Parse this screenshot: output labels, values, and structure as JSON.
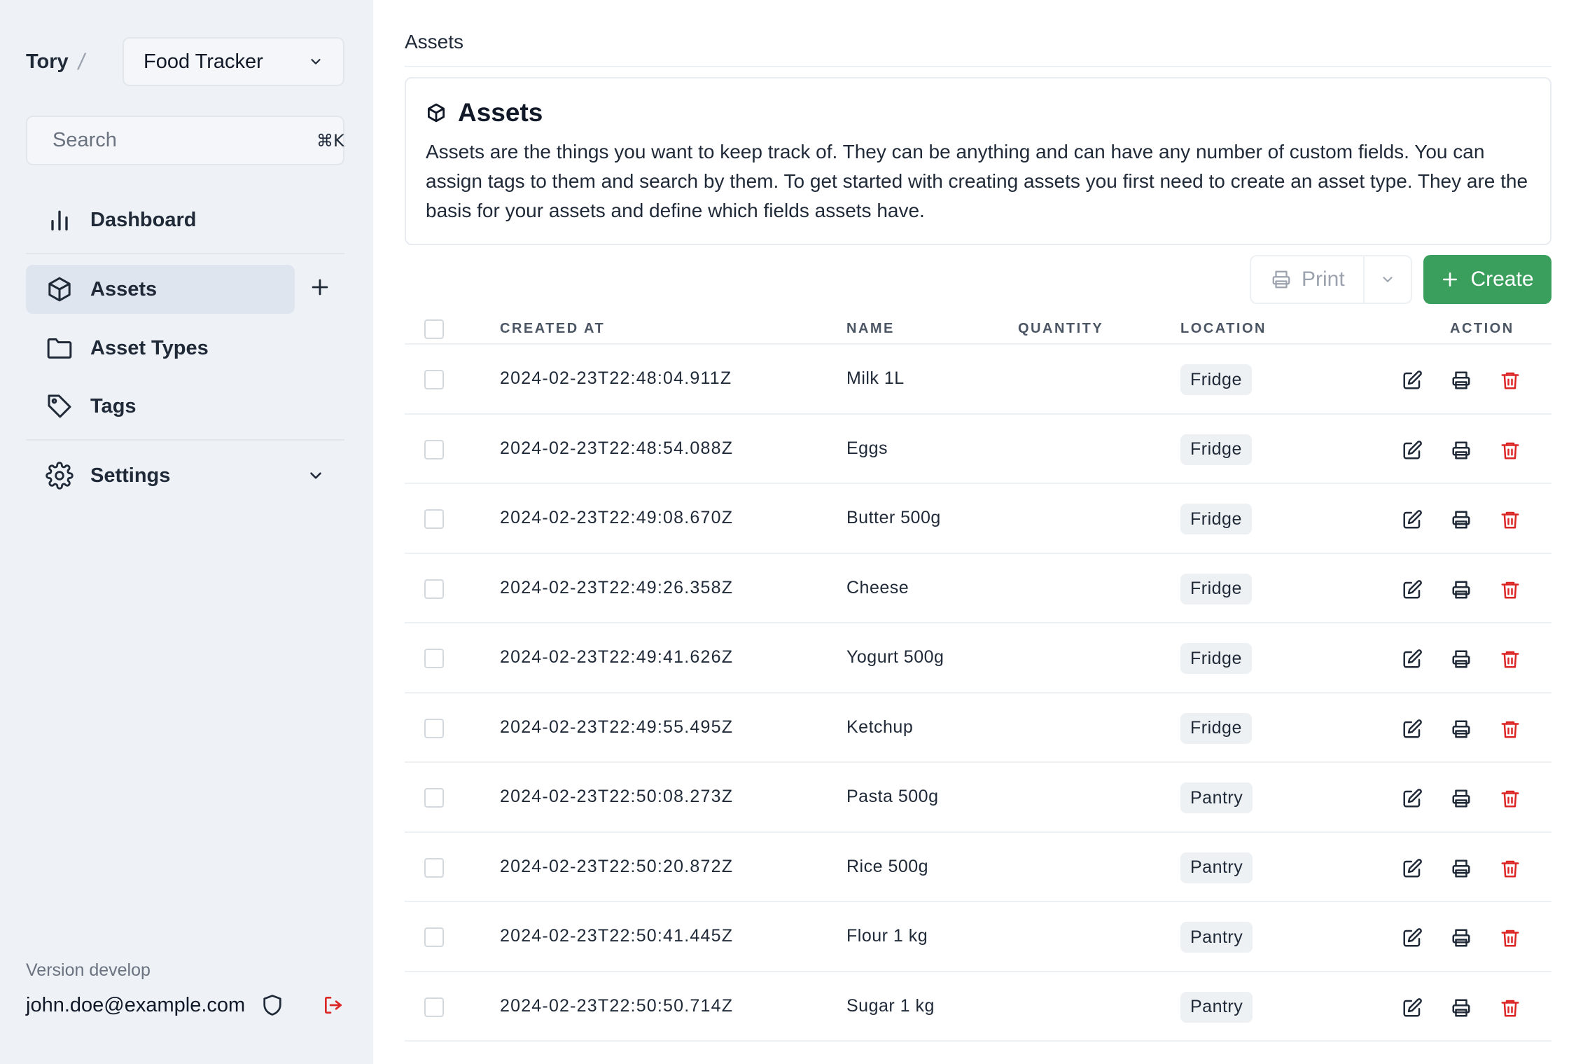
{
  "sidebar": {
    "team": "Tory",
    "separator": "/",
    "project": "Food Tracker",
    "search": {
      "placeholder": "Search",
      "shortcut": "⌘K"
    },
    "nav": {
      "dashboard": "Dashboard",
      "assets": "Assets",
      "asset_types": "Asset Types",
      "tags": "Tags",
      "settings": "Settings"
    },
    "version": "Version develop",
    "user_email": "john.doe@example.com"
  },
  "main": {
    "breadcrumb": "Assets",
    "intro": {
      "title": "Assets",
      "text": "Assets are the things you want to keep track of. They can be anything and can have any number of custom fields. You can assign tags to them and search by them. To get started with creating assets you first need to create an asset type. They are the basis for your assets and define which fields assets have."
    },
    "toolbar": {
      "print_label": "Print",
      "create_label": "Create"
    },
    "table": {
      "columns": {
        "created_at": "CREATED AT",
        "name": "NAME",
        "quantity": "QUANTITY",
        "location": "LOCATION",
        "action": "ACTION"
      },
      "rows": [
        {
          "created_at": "2024-02-23T22:48:04.911Z",
          "name": "Milk 1L",
          "quantity": "",
          "location": "Fridge"
        },
        {
          "created_at": "2024-02-23T22:48:54.088Z",
          "name": "Eggs",
          "quantity": "",
          "location": "Fridge"
        },
        {
          "created_at": "2024-02-23T22:49:08.670Z",
          "name": "Butter 500g",
          "quantity": "",
          "location": "Fridge"
        },
        {
          "created_at": "2024-02-23T22:49:26.358Z",
          "name": "Cheese",
          "quantity": "",
          "location": "Fridge"
        },
        {
          "created_at": "2024-02-23T22:49:41.626Z",
          "name": "Yogurt 500g",
          "quantity": "",
          "location": "Fridge"
        },
        {
          "created_at": "2024-02-23T22:49:55.495Z",
          "name": "Ketchup",
          "quantity": "",
          "location": "Fridge"
        },
        {
          "created_at": "2024-02-23T22:50:08.273Z",
          "name": "Pasta 500g",
          "quantity": "",
          "location": "Pantry"
        },
        {
          "created_at": "2024-02-23T22:50:20.872Z",
          "name": "Rice 500g",
          "quantity": "",
          "location": "Pantry"
        },
        {
          "created_at": "2024-02-23T22:50:41.445Z",
          "name": "Flour 1 kg",
          "quantity": "",
          "location": "Pantry"
        },
        {
          "created_at": "2024-02-23T22:50:50.714Z",
          "name": "Sugar 1 kg",
          "quantity": "",
          "location": "Pantry"
        }
      ]
    }
  },
  "colors": {
    "sidebar_bg": "#eef2f6",
    "active_nav_bg": "#dfe5ee",
    "create_button": "#3a9f5c",
    "delete_icon": "#dc2626",
    "logout_icon": "#dc2626",
    "badge_bg": "#eef1f4"
  },
  "icons": {
    "search": "search-icon",
    "dashboard": "bar-chart-icon",
    "assets": "cube-icon",
    "asset_types": "folder-icon",
    "tags": "tag-icon",
    "settings": "gear-icon",
    "add": "plus-icon",
    "shield": "shield-icon",
    "logout": "logout-icon",
    "print": "printer-icon",
    "edit": "edit-icon",
    "delete": "trash-icon"
  }
}
